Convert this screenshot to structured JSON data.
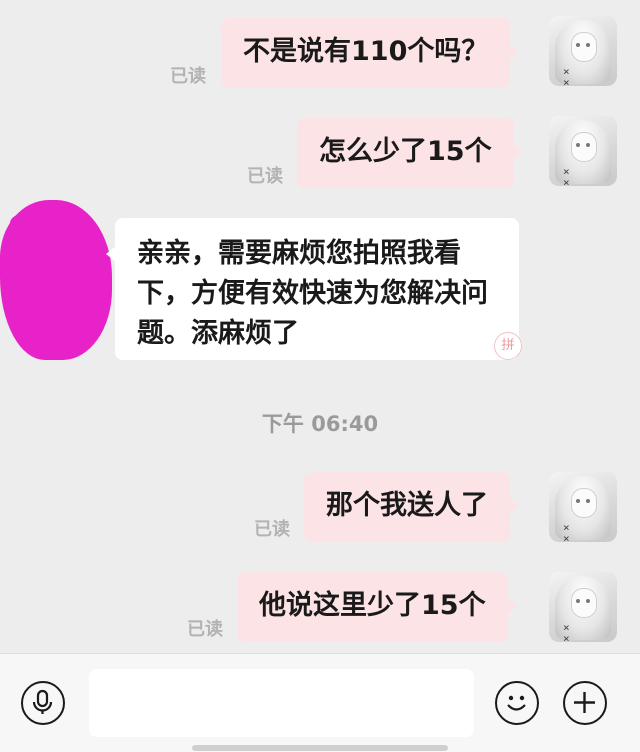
{
  "chat": {
    "messages": [
      {
        "direction": "out",
        "text": "不是说有110个吗？",
        "read_label": "已读"
      },
      {
        "direction": "out",
        "text": "怎么少了15个",
        "read_label": "已读"
      },
      {
        "direction": "in",
        "text": "亲亲，需要麻烦您拍照我看下，方便有效快速为您解决问题。添麻烦了"
      },
      {
        "direction": "out",
        "text": "那个我送人了",
        "read_label": "已读"
      },
      {
        "direction": "out",
        "text": "他说这里少了15个",
        "read_label": "已读"
      }
    ],
    "timestamp": "下午 06:40",
    "stamp_glyph": "拼"
  },
  "input_bar": {
    "voice_icon": "microphone-icon",
    "emoji_icon": "smiley-icon",
    "more_icon": "plus-icon",
    "text_value": ""
  },
  "colors": {
    "outgoing_bubble": "#fbe3e6",
    "incoming_bubble": "#ffffff",
    "background": "#ededed",
    "redaction": "#e622c8"
  }
}
